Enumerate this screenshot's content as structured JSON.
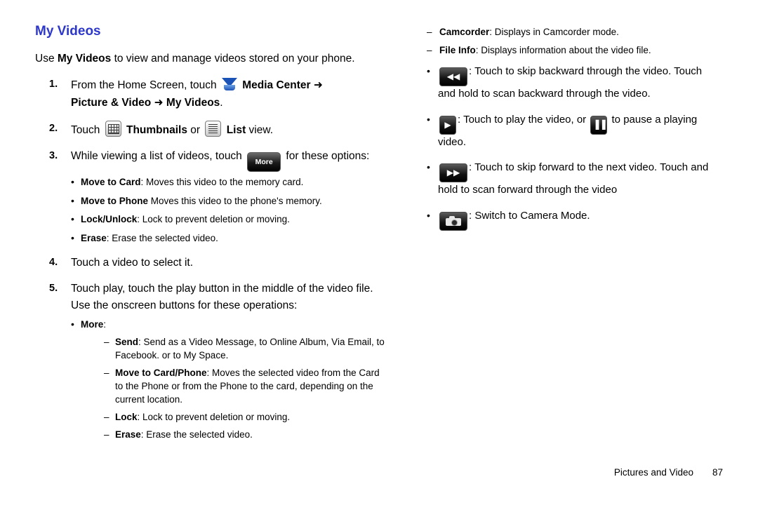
{
  "document": {
    "title": "My Videos",
    "intro_prefix": "Use ",
    "intro_bold": "My Videos",
    "intro_suffix": " to view and manage videos stored on your phone.",
    "footer_section": "Pictures and Video",
    "footer_page": "87",
    "title_color": "#2d37c9"
  },
  "steps": [
    {
      "num": "1.",
      "part1": "From the Home Screen, touch ",
      "icon": "media-center-icon",
      "bold1": "Media Center",
      "arrow1": "➜",
      "bold2": "Picture & Video",
      "arrow2": "➜",
      "bold3": "My Videos",
      "end": "."
    },
    {
      "num": "2.",
      "part1": "Touch ",
      "icon1": "thumbnails-grid-icon",
      "bold1": "Thumbnails",
      "mid": " or ",
      "icon2": "list-view-icon",
      "bold2": "List",
      "end": " view."
    },
    {
      "num": "3.",
      "part1": "While viewing a list of videos, touch ",
      "button_label": "More",
      "part2": " for these options:",
      "bullets": [
        {
          "bold": "Move to Card",
          "text": ": Moves this video to the memory card."
        },
        {
          "bold": "Move to Phone",
          "text": " Moves this video to the phone's memory."
        },
        {
          "bold": "Lock/Unlock",
          "text": ": Lock to prevent deletion or moving."
        },
        {
          "bold": "Erase",
          "text": ": Erase the selected video."
        }
      ]
    },
    {
      "num": "4.",
      "part1": "Touch a video to select it."
    },
    {
      "num": "5.",
      "part1": "Touch play, touch the play button in the middle of the video file. Use the onscreen buttons for these operations:",
      "more_bullet": "More",
      "more_colon": ":",
      "sub_items": [
        {
          "bold": "Send",
          "text": ": Send as a Video Message, to Online Album, Via Email, to Facebook. or to My Space."
        },
        {
          "bold": "Move to Card/Phone",
          "text": ": Moves the selected video from the Card to the Phone or from the Phone to the card, depending on the current location."
        },
        {
          "bold": "Lock",
          "text": ": Lock to prevent deletion or moving."
        },
        {
          "bold": "Erase",
          "text": ": Erase the selected video."
        }
      ]
    }
  ],
  "right_column": {
    "dashes": [
      {
        "bold": "Camcorder",
        "text": ": Displays in Camcorder mode."
      },
      {
        "bold": "File Info",
        "text": ": Displays information about the video file."
      }
    ],
    "bullets": [
      {
        "icon": "skip-backward-icon",
        "glyph": "◀◀",
        "text": ": Touch to skip backward through the video. Touch and hold to scan backward through the video."
      },
      {
        "icon": "play-icon",
        "glyph": "▶",
        "text_pre": ": Touch to play the video, or ",
        "icon2": "pause-icon",
        "glyph2": "▐▐",
        "text_post": " to pause a playing video."
      },
      {
        "icon": "skip-forward-icon",
        "glyph": "▶▶",
        "text": ": Touch to skip forward to the next video. Touch and hold to scan forward through the video"
      },
      {
        "icon": "camera-mode-icon",
        "glyph": "",
        "text": ": Switch to Camera Mode."
      }
    ]
  }
}
